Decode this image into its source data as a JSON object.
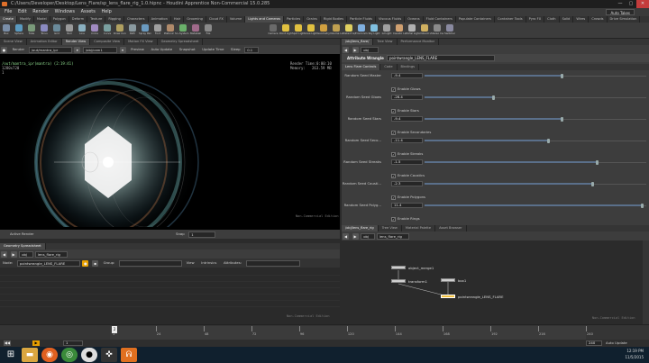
{
  "window": {
    "title": "C:/Users/Developer/Desktop/Lens_Flare/sp_lens_flare_rig_1.0.hipnc - Houdini Apprentice Non-Commercial 15.0.285",
    "close": "✕",
    "minimize": "—",
    "maximize": "▢"
  },
  "menu": [
    "File",
    "Edit",
    "Render",
    "Windows",
    "Assets",
    "Help"
  ],
  "desktop_dropdown": "Auto Takes",
  "shelf_tabs": [
    "Create",
    "Modify",
    "Model",
    "Polygon",
    "Deform",
    "Texture",
    "Rigging",
    "Characters",
    "Animation",
    "Hair",
    "Grooming",
    "Cloud FX",
    "Volume",
    "Lights and Cameras",
    "Particles",
    "Grains",
    "Rigid Bodies",
    "Particle Fluids",
    "Viscous Fluids",
    "Oceans",
    "Fluid Containers",
    "Populate Containers",
    "Container Tools",
    "Pyro FX",
    "Cloth",
    "Solid",
    "Wires",
    "Crowds",
    "Drive Simulation"
  ],
  "shelf_tools_left": [
    "Box",
    "Sphere",
    "Tube",
    "Torus",
    "Grid",
    "Null",
    "Line",
    "Circle",
    "Curve",
    "Draw Curve",
    "Path",
    "Spray Paint",
    "Font",
    "Platonic Solids",
    "L-System",
    "Metaball",
    "File"
  ],
  "shelf_tools_right": [
    "Camera",
    "Point Light",
    "Spot Light",
    "Area Light",
    "Geometry Light",
    "Volume Light",
    "Distant Light",
    "Environment Light",
    "Sky Light",
    "GI Light",
    "Caustic Light",
    "Portal Light",
    "Ambient Light",
    "Stereo Cam",
    "Switcher"
  ],
  "viewer": {
    "tabs": [
      "Scene View",
      "Animation Editor",
      "Render View",
      "Composite View",
      "Motion FX View",
      "Geometry Spreadsheet"
    ],
    "active_tab": "Render View",
    "render_btn": "Render",
    "rop": "/out/mantra_ipr",
    "camera": "/obj/cam1",
    "preview": "Preview",
    "autoupdate": "Auto Update",
    "snapshot": "Snapshot",
    "update_time": "Update Time",
    "sleep": "Sleep",
    "sleep_val": "0.1",
    "path_text": "/out/mantra_ipr(mantra) (2:19:41)",
    "resolution": "1280x720",
    "frame_text": "1",
    "render_time_label": "Render Time:",
    "render_time": "0:00:10",
    "memory_label": "Memory:",
    "memory": "263.59 MB",
    "watermark": "Non-Commercial Edition",
    "active_render": "Active Render",
    "snap_label": "Snap",
    "snap_val": "1"
  },
  "params": {
    "tabs": [
      "/obj/lens_flare/",
      "Tree View",
      "Performance Monitor"
    ],
    "path": "obj",
    "type_label": "Attribute Wrangle",
    "node_name": "pointwrangle_LENS_FLARE",
    "subtabs": [
      "Lens Flare Controls",
      "Code",
      "Bindings"
    ],
    "rows": [
      {
        "check": null,
        "label": "Random Seed Master",
        "value": "-9.4",
        "fill": 0.62
      },
      {
        "check": "Enable Glows",
        "label": "Random Seed Glows",
        "value": "-26.4",
        "fill": 0.31
      },
      {
        "check": "Enable Stars",
        "label": "Random Seed Stars",
        "value": "-9.4",
        "fill": 0.62
      },
      {
        "check": "Enable Secondaries",
        "label": "Random Seed Seco...",
        "value": "-11.4",
        "fill": 0.56
      },
      {
        "check": "Enable Streaks",
        "label": "Random Seed Streaks",
        "value": "-1.5",
        "fill": 0.78
      },
      {
        "check": "Enable Caustics",
        "label": "Random Seed Causti...",
        "value": "-2.3",
        "fill": 0.76
      },
      {
        "check": "Enable Polygons",
        "label": "Random Seed Polyg...",
        "value": "11.4",
        "fill": 0.98
      },
      {
        "check": "Enable Rings",
        "label": null,
        "value": null,
        "fill": null
      }
    ]
  },
  "sheet": {
    "tabs": [
      "Geometry Spreadsheet"
    ],
    "path": "obj",
    "subpath": "lens_flare_rig",
    "node_label": "Node:",
    "node_value": "pointwrangle_LENS_FLARE",
    "group_label": "Group:",
    "view_label": "View",
    "intrinsics_label": "Intrinsics",
    "attributes_label": "Attributes:",
    "watermark": "Non-Commercial Edition"
  },
  "network": {
    "tabs": [
      "/obj/lens_flare_rig",
      "Tree View",
      "Material Palette",
      "Asset Browser"
    ],
    "path": "obj",
    "subpath": "lens_flare_rig",
    "nodes": [
      "object_merge1",
      "transform1",
      "box1",
      "pointwrangle_LENS_FLARE"
    ],
    "watermark": "Non-Commercial Edition"
  },
  "timeline": {
    "ticks": [
      "2",
      "24",
      "48",
      "72",
      "96",
      "120",
      "144",
      "168",
      "192",
      "216",
      "240"
    ],
    "current_frame": "2",
    "start": "1",
    "end": "240",
    "realtime": "Auto Update",
    "frame_field": "1",
    "frame_field_end": "240"
  },
  "taskbar": {
    "apps": [
      "start-button",
      "file-explorer",
      "firefox",
      "chrome",
      "recorder",
      "game-controller",
      "houdini"
    ],
    "time": "12:19 PM",
    "date": "11/5/2015"
  },
  "colors": {
    "accent": "#e8a000",
    "selected_node": "#f0c040",
    "slider_fill": "#5a6f8a"
  }
}
